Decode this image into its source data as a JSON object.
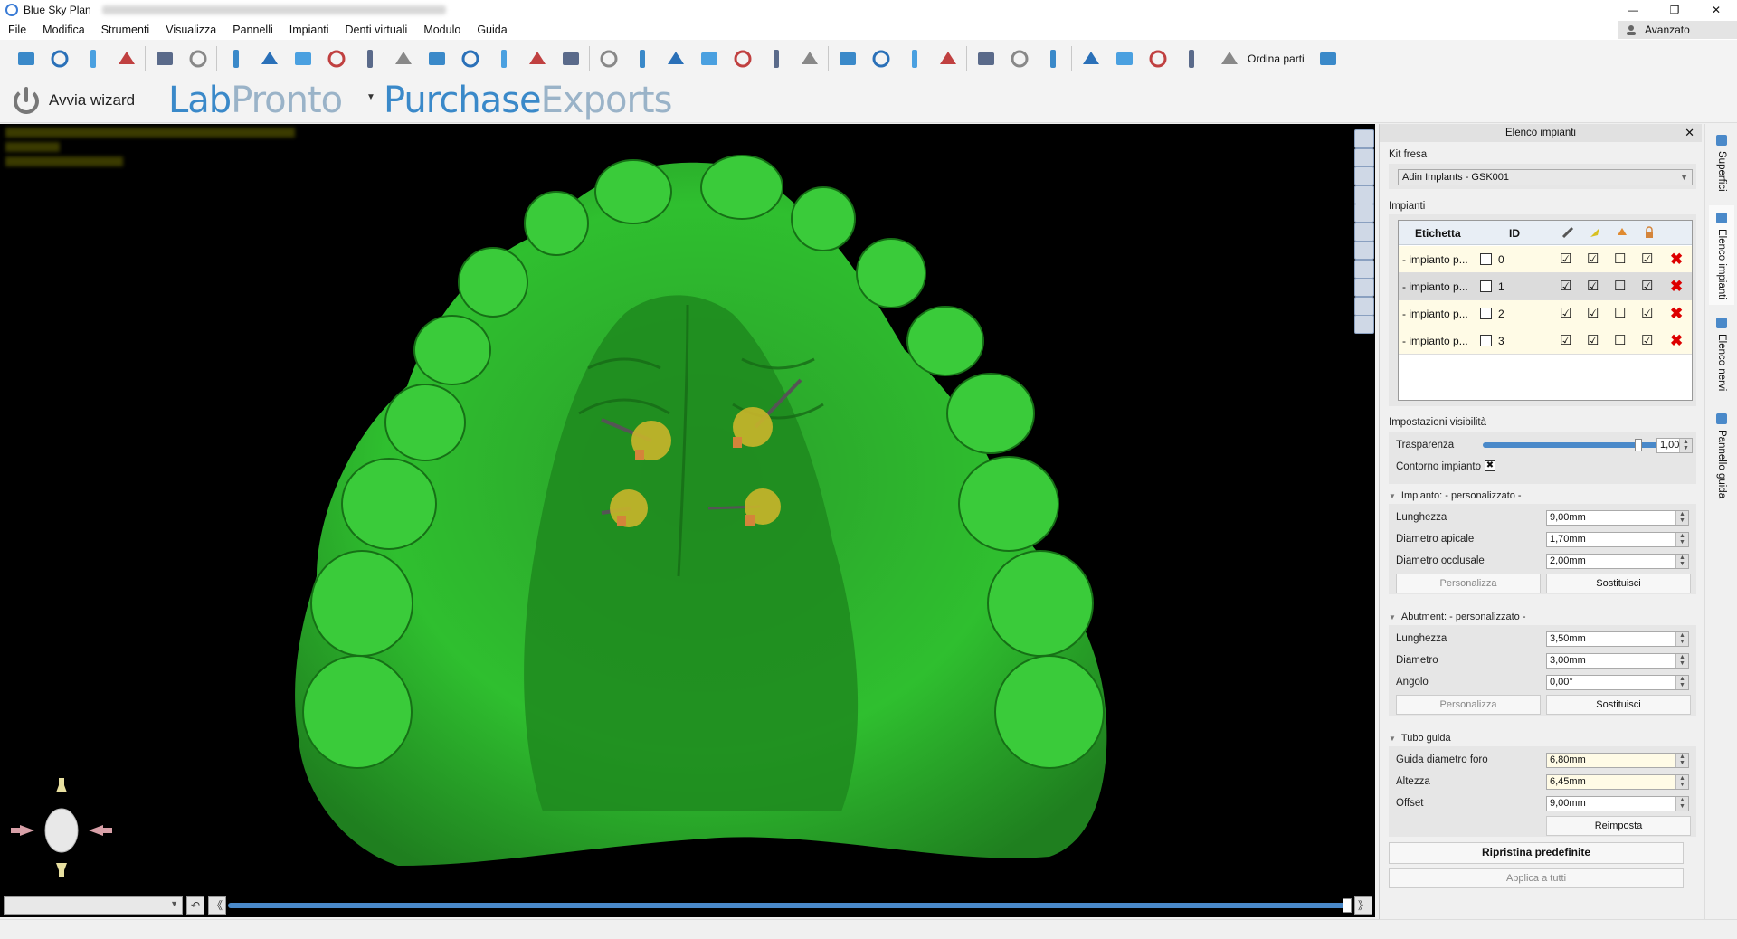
{
  "window": {
    "app_title": "Blue Sky Plan",
    "minimize": "—",
    "maximize": "❐",
    "close": "✕"
  },
  "menu": {
    "items": [
      "File",
      "Modifica",
      "Strumenti",
      "Visualizza",
      "Pannelli",
      "Impianti",
      "Denti virtuali",
      "Modulo",
      "Guida"
    ],
    "avanzato": "Avanzato"
  },
  "toolbar": {
    "icons": [
      "new-project-icon",
      "open-icon",
      "save-icon",
      "close-project-icon",
      "undo-icon",
      "redo-icon",
      "panoramic-icon",
      "slice-icon",
      "zoom-search-icon",
      "curve-icon",
      "arch-icon",
      "measure-icon",
      "bone-density-icon",
      "implant-icon",
      "nerve-icon",
      "abutment-icon",
      "settings-icon",
      "ruler-vertical-icon",
      "ruler-drill-icon",
      "guide-icon",
      "tooth-icon",
      "sleeve-icon",
      "visibility-icon",
      "export-icon",
      "gradient-icon",
      "rotate-icon",
      "zoom-icon",
      "pan-icon",
      "surface-icon",
      "sculpt-icon",
      "protractor-icon",
      "rotation-icon",
      "align-icon",
      "upload-icon",
      "cloud-icon",
      "cart-icon",
      "expand-icon"
    ],
    "ordina_parti": "Ordina parti"
  },
  "wizard": {
    "label": "Avvia wizard",
    "brand_lab": "Lab",
    "brand_pronto": "Pronto",
    "brand_purchase": "Purchase",
    "brand_exports": "Exports"
  },
  "panel": {
    "title": "Elenco impianti",
    "kit_label": "Kit fresa",
    "kit_value": "Adin Implants - GSK001",
    "impianti_label": "Impianti",
    "table": {
      "headers": {
        "etichetta": "Etichetta",
        "id": "ID"
      },
      "rows": [
        {
          "label": "- impianto p...",
          "id": "0",
          "c1": "☑",
          "c2": "☑",
          "c3": "☐",
          "c4": "☑"
        },
        {
          "label": "- impianto p...",
          "id": "1",
          "c1": "☑",
          "c2": "☑",
          "c3": "☐",
          "c4": "☑"
        },
        {
          "label": "- impianto p...",
          "id": "2",
          "c1": "☑",
          "c2": "☑",
          "c3": "☐",
          "c4": "☑"
        },
        {
          "label": "- impianto p...",
          "id": "3",
          "c1": "☑",
          "c2": "☑",
          "c3": "☐",
          "c4": "☑"
        }
      ],
      "delete_glyph": "✖"
    },
    "visibility": {
      "title": "Impostazioni visibilità",
      "trasparenza_label": "Trasparenza",
      "trasparenza_value": "1,00",
      "trasparenza_level": 1.0,
      "contorno_label": "Contorno impianto"
    },
    "implant": {
      "title": "Impianto: - personalizzato -",
      "lunghezza_label": "Lunghezza",
      "lunghezza_value": "9,00mm",
      "apicale_label": "Diametro apicale",
      "apicale_value": "1,70mm",
      "occlusale_label": "Diametro occlusale",
      "occlusale_value": "2,00mm",
      "personalizza": "Personalizza",
      "sostituisci": "Sostituisci"
    },
    "abutment": {
      "title": "Abutment: - personalizzato -",
      "lunghezza_label": "Lunghezza",
      "lunghezza_value": "3,50mm",
      "diametro_label": "Diametro",
      "diametro_value": "3,00mm",
      "angolo_label": "Angolo",
      "angolo_value": "0,00°",
      "personalizza": "Personalizza",
      "sostituisci": "Sostituisci"
    },
    "tubo": {
      "title": "Tubo guida",
      "foro_label": "Guida diametro foro",
      "foro_value": "6,80mm",
      "altezza_label": "Altezza",
      "altezza_value": "6,45mm",
      "offset_label": "Offset",
      "offset_value": "9,00mm",
      "reimposta": "Reimposta"
    },
    "ripristina": "Ripristina predefinite",
    "applica": "Applica a tutti"
  },
  "side_tabs": [
    "Superfici",
    "Elenco impianti",
    "Elenco nervi",
    "Pannello guida"
  ],
  "viewport": {
    "nav_prev": "《",
    "nav_next": "》",
    "nav_reset": "↶",
    "timeline_level": 0.99
  },
  "colors": {
    "model_green": "#2fbf2f",
    "implant_yellow": "#c9b52a",
    "accent_blue": "#3a89c9"
  }
}
